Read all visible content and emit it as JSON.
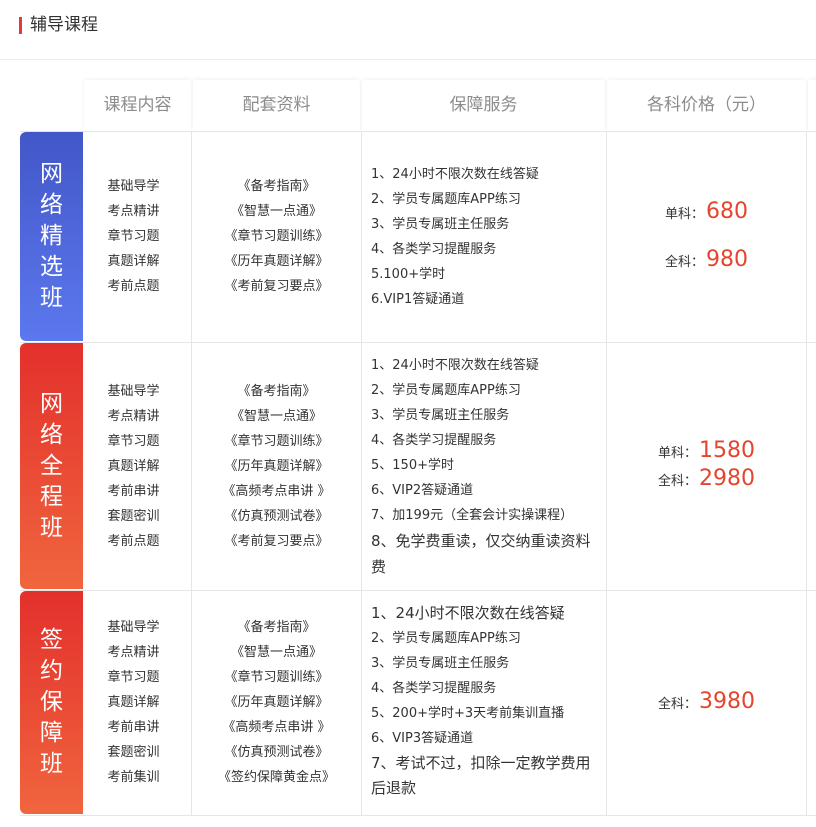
{
  "section": {
    "title": "辅导课程"
  },
  "columns": [
    "课程内容",
    "配套资料",
    "保障服务",
    "各科价格（元）"
  ],
  "rows": [
    {
      "name": "网络精选班",
      "content": [
        "基础导学",
        "考点精讲",
        "章节习题",
        "真题详解",
        "考前点题"
      ],
      "materials": [
        "《备考指南》",
        "《智慧一点通》",
        "《章节习题训练》",
        "《历年真题详解》",
        "《考前复习要点》"
      ],
      "services": [
        "1、24小时不限次数在线答疑",
        "2、学员专属题库APP练习",
        "3、学员专属班主任服务",
        "4、各类学习提醒服务",
        "5.100+学时",
        "6.VIP1答疑通道"
      ],
      "prices": [
        {
          "label": "单科：",
          "value": "680"
        },
        {
          "label": "全科：",
          "value": "980"
        }
      ]
    },
    {
      "name": "网络全程班",
      "content": [
        "基础导学",
        "考点精讲",
        "章节习题",
        "真题详解",
        "考前串讲",
        "套题密训",
        "考前点题"
      ],
      "materials": [
        "《备考指南》",
        "《智慧一点通》",
        "《章节习题训练》",
        "《历年真题详解》",
        "《高频考点串讲 》",
        "《仿真预测试卷》",
        "《考前复习要点》"
      ],
      "services": [
        "1、24小时不限次数在线答疑",
        "2、学员专属题库APP练习",
        "3、学员专属班主任服务",
        "4、各类学习提醒服务",
        "5、150+学时",
        "6、VIP2答疑通道",
        "7、加199元（全套会计实操课程）",
        "8、免学费重读，仅交纳重读资料费"
      ],
      "prices": [
        {
          "label": "单科：",
          "value": "1580"
        },
        {
          "label": "全科：",
          "value": "2980"
        }
      ]
    },
    {
      "name": "签约保障班",
      "content": [
        "基础导学",
        "考点精讲",
        "章节习题",
        "真题详解",
        "考前串讲",
        "套题密训",
        "考前集训"
      ],
      "materials": [
        "《备考指南》",
        "《智慧一点通》",
        "《章节习题训练》",
        "《历年真题详解》",
        "《高频考点串讲 》",
        "《仿真预测试卷》",
        "《签约保障黄金点》"
      ],
      "services": [
        "1、24小时不限次数在线答疑",
        "2、学员专属题库APP练习",
        "3、学员专属班主任服务",
        "4、各类学习提醒服务",
        "5、200+学时+3天考前集训直播",
        "6、VIP3答疑通道",
        "7、考试不过，扣除一定教学费用后退款"
      ],
      "prices": [
        {
          "label": "全科：",
          "value": "3980"
        }
      ]
    }
  ]
}
